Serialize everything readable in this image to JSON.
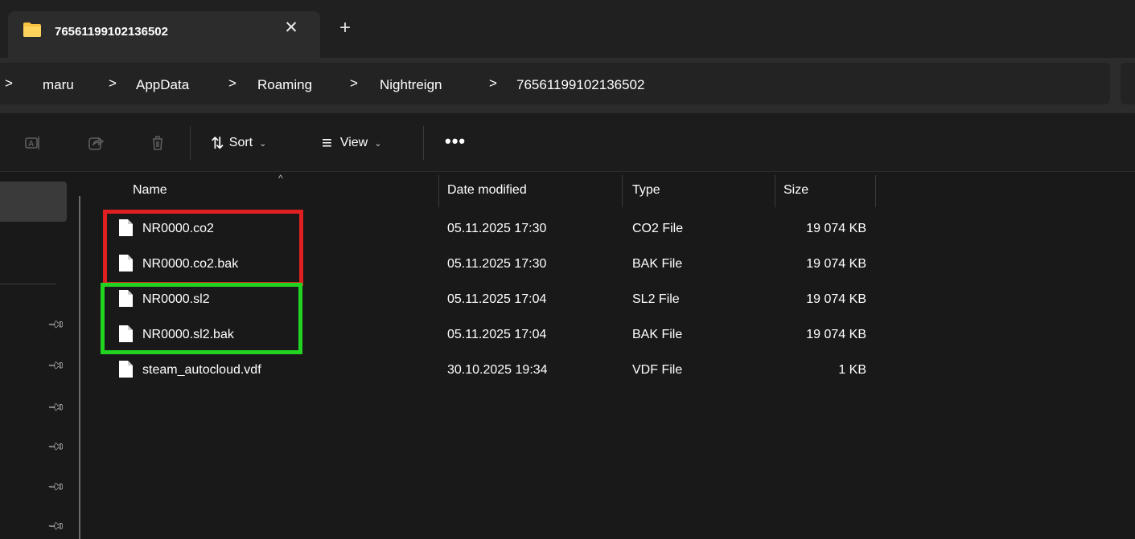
{
  "window": {
    "tab_title": "76561199102136502",
    "tab_close_glyph": "✕",
    "new_tab_glyph": "+"
  },
  "breadcrumb": {
    "leading_separator": ">",
    "items": [
      "maru",
      "AppData",
      "Roaming",
      "Nightreign",
      "76561199102136502"
    ],
    "separator": ">"
  },
  "toolbar": {
    "rename_icon": "rename-icon",
    "share_icon": "share-icon",
    "delete_icon": "delete-icon",
    "sort_label": "Sort",
    "view_label": "View",
    "more_label": "•••",
    "sort_icon": "⇅",
    "view_icon": "≡",
    "chevron": "⌄"
  },
  "file_list": {
    "columns": {
      "name": "Name",
      "date": "Date modified",
      "type": "Type",
      "size": "Size"
    },
    "sort_indicator": "^",
    "rows": [
      {
        "name": "NR0000.co2",
        "date": "05.11.2025 17:30",
        "type": "CO2 File",
        "size": "19 074 KB"
      },
      {
        "name": "NR0000.co2.bak",
        "date": "05.11.2025 17:30",
        "type": "BAK File",
        "size": "19 074 KB"
      },
      {
        "name": "NR0000.sl2",
        "date": "05.11.2025 17:04",
        "type": "SL2 File",
        "size": "19 074 KB"
      },
      {
        "name": "NR0000.sl2.bak",
        "date": "05.11.2025 17:04",
        "type": "BAK File",
        "size": "19 074 KB"
      },
      {
        "name": "steam_autocloud.vdf",
        "date": "30.10.2025 19:34",
        "type": "VDF File",
        "size": "1 KB"
      }
    ]
  },
  "annotations": {
    "red_box_color": "#e02020",
    "green_box_color": "#22d322"
  },
  "colors": {
    "background": "#191919",
    "tab_bar": "#202020",
    "active_tab": "#2c2c2c",
    "folder": "#f6c343"
  }
}
